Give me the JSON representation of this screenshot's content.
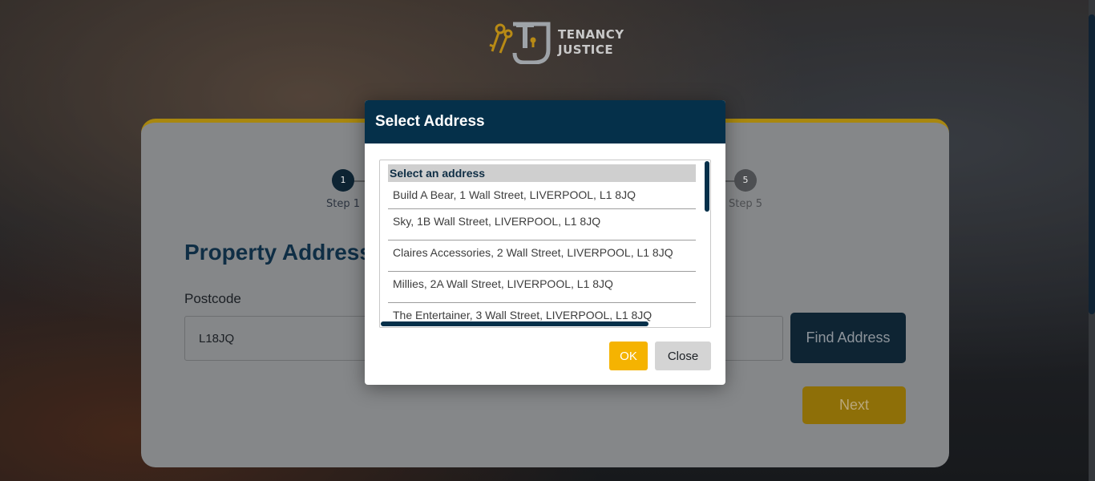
{
  "logo": {
    "line1": "TENANCY",
    "line2": "JUSTICE"
  },
  "steps": [
    {
      "number": "1",
      "label": "Step 1"
    },
    {
      "number": "5",
      "label": "Step 5"
    }
  ],
  "form": {
    "title": "Property Address",
    "postcode_label": "Postcode",
    "postcode_value": "L18JQ",
    "find_button": "Find Address",
    "next_button": "Next"
  },
  "modal": {
    "title": "Select Address",
    "list_heading": "Select an address",
    "addresses": [
      "Build A Bear, 1 Wall Street, LIVERPOOL, L1 8JQ",
      "Sky, 1B Wall Street, LIVERPOOL, L1 8JQ",
      "Claires Accessories, 2 Wall Street, LIVERPOOL, L1 8JQ",
      "Millies, 2A Wall Street, LIVERPOOL, L1 8JQ",
      "The Entertainer, 3 Wall Street, LIVERPOOL, L1 8JQ"
    ],
    "ok_button": "OK",
    "close_button": "Close"
  },
  "colors": {
    "brand_navy": "#05304a",
    "accent_yellow": "#f5b301",
    "card_border": "#a8870f"
  }
}
